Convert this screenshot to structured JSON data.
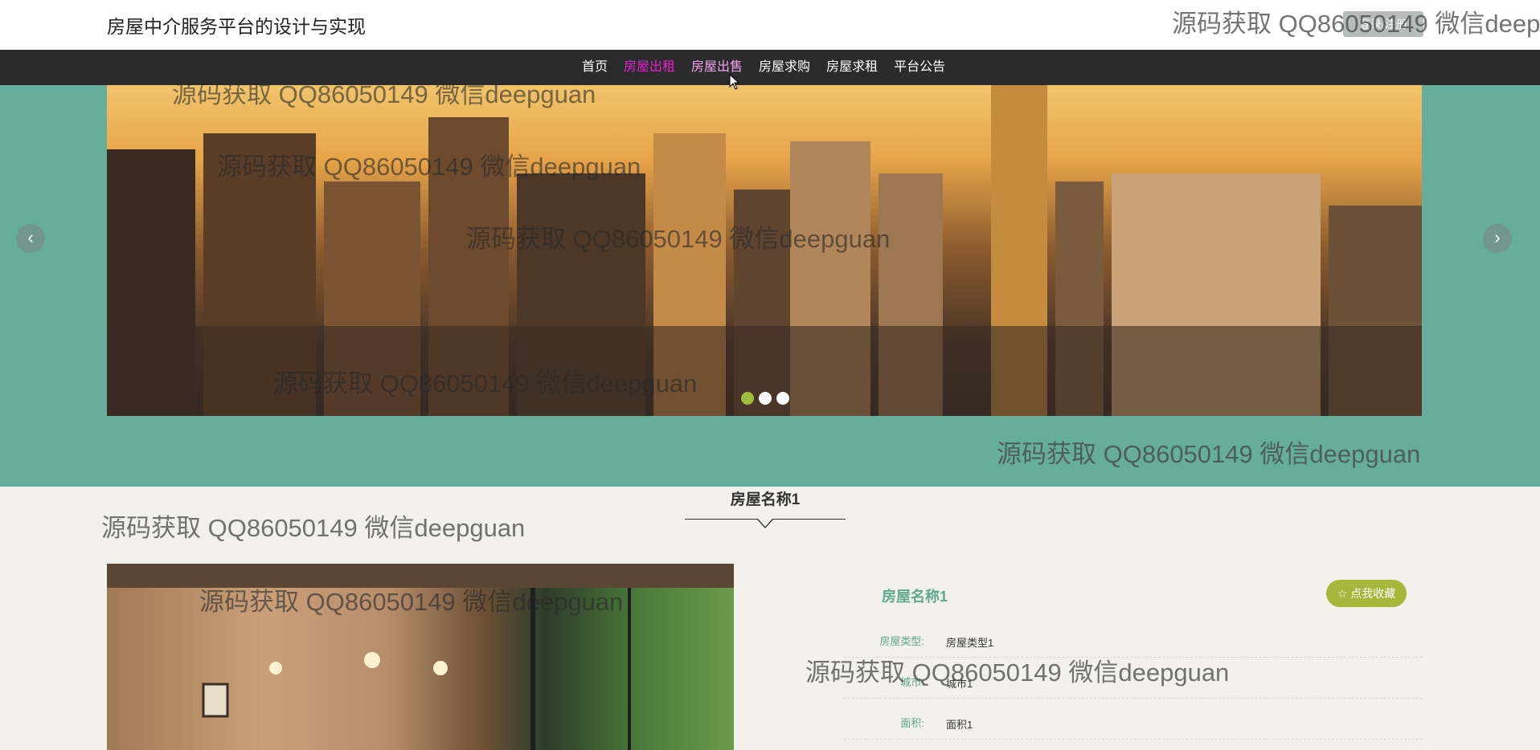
{
  "header": {
    "site_title": "房屋中介服务平台的设计与实现",
    "auth_button": "登录/注册"
  },
  "nav": {
    "items": [
      "首页",
      "房屋出租",
      "房屋出售",
      "房屋求购",
      "房屋求租",
      "平台公告"
    ]
  },
  "carousel": {
    "prev": "‹",
    "next": "›",
    "slide_count": 3,
    "active_slide": 1
  },
  "section": {
    "title": "房屋名称1"
  },
  "detail": {
    "name": "房屋名称1",
    "favorite_button": "☆ 点我收藏",
    "fields": [
      {
        "label": "房屋类型:",
        "value": "房屋类型1"
      },
      {
        "label": "城市:",
        "value": "城市1"
      },
      {
        "label": "面积:",
        "value": "面积1"
      }
    ]
  },
  "watermark": {
    "text": "源码获取 QQ86050149 微信deepguan"
  },
  "colors": {
    "accent_green": "#5fa890",
    "nav_active": "#e61fd3",
    "fav_button": "#a6b83b",
    "hero_bg": "#66ad9b"
  }
}
